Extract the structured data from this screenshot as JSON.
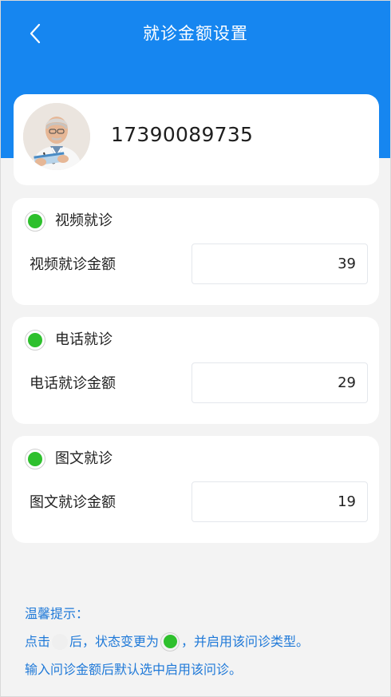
{
  "header": {
    "title": "就诊金额设置",
    "back_icon": "chevron-left-icon",
    "background_color": "#1686f0"
  },
  "profile": {
    "phone": "17390089735",
    "avatar": "doctor-avatar"
  },
  "consult_types": [
    {
      "title": "视频就诊",
      "label": "视频就诊金额",
      "value": "39",
      "enabled": true
    },
    {
      "title": "电话就诊",
      "label": "电话就诊金额",
      "value": "29",
      "enabled": true
    },
    {
      "title": "图文就诊",
      "label": "图文就诊金额",
      "value": "19",
      "enabled": true
    }
  ],
  "tips": {
    "heading": "温馨提示：",
    "line1_pre": "点击",
    "line1_mid": "后，状态变更为",
    "line1_post": "，并启用该问诊类型。",
    "line2": "输入问诊金额后默认选中启用该问诊。",
    "color": "#1f79d8"
  },
  "colors": {
    "active_green": "#2ec02d",
    "page_background": "#f3f3f3"
  }
}
